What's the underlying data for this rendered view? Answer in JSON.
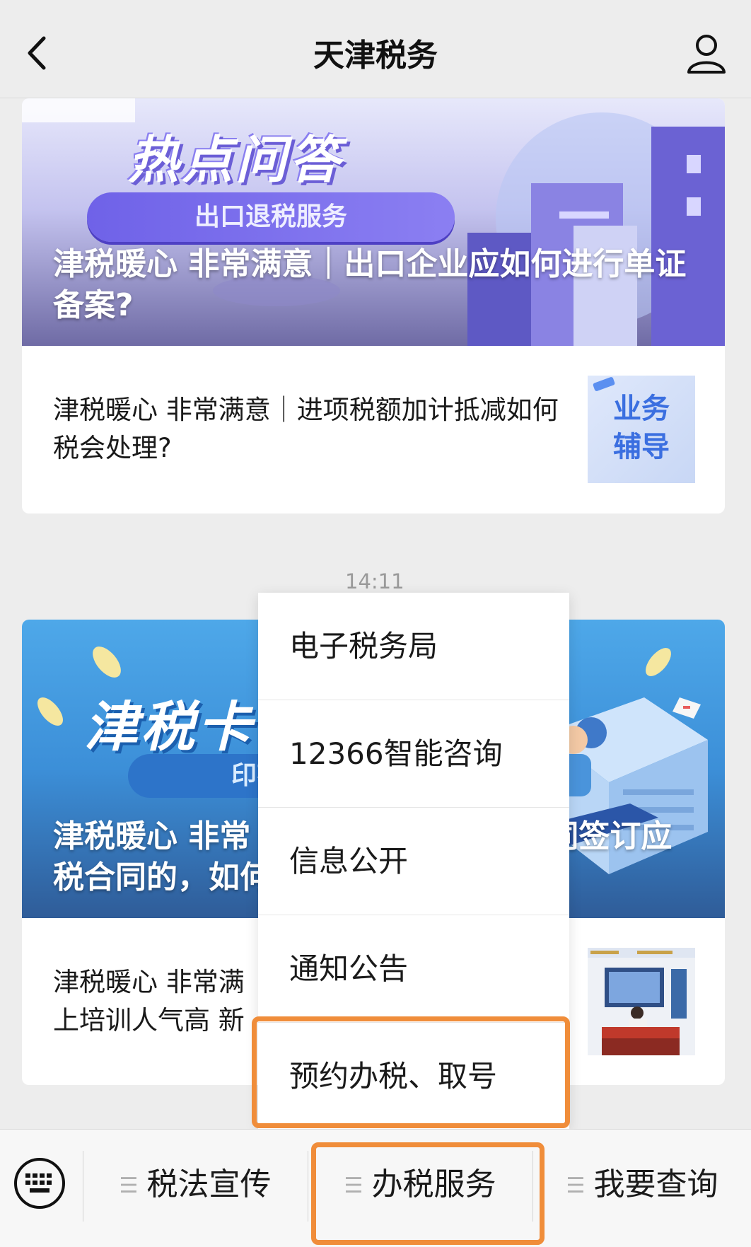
{
  "header": {
    "title": "天津税务",
    "back_icon": "chevron-left-icon",
    "profile_icon": "person-icon"
  },
  "articles": [
    {
      "banner_headline": "热点问答",
      "banner_pill": "出口退税服务",
      "banner_title": "津税暖心 非常满意｜出口企业应如何进行单证备案?",
      "sub_title": "津税暖心 非常满意｜进项税额加计抵减如何税会处理?",
      "thumb_label_line1": "业务",
      "thumb_label_line2": "辅导"
    },
    {
      "banner_headline": "津税卡",
      "banner_pill": "印花税",
      "banner_title_left_l1": "津税暖心 非常",
      "banner_title_left_l2": "税合同的，如何",
      "banner_title_right_l1": "同签订应",
      "sub_title_l1": "津税暖心 非常满",
      "sub_title_l2": "上培训人气高 新"
    }
  ],
  "timestamp": "14:11",
  "popup_menu": {
    "items": [
      "电子税务局",
      "12366智能咨询",
      "信息公开",
      "通知公告",
      "预约办税、取号"
    ],
    "highlighted_index": 4
  },
  "bottom_bar": {
    "keyboard_icon": "keyboard-icon",
    "tabs": [
      "税法宣传",
      "办税服务",
      "我要查询"
    ],
    "active_tab": "办税服务"
  },
  "colors": {
    "highlight": "#f08d3a",
    "background": "#ededed",
    "bar": "#f7f7f7"
  }
}
